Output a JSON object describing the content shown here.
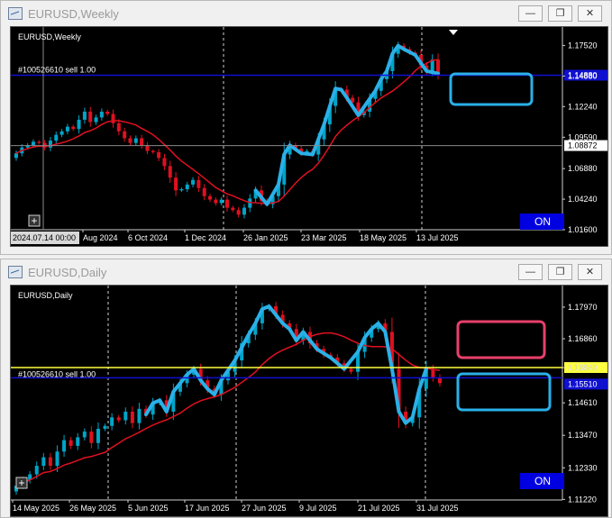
{
  "windows": [
    {
      "title": "EURUSD,Weekly",
      "symbol_label": "EURUSD,Weekly",
      "order_line_label": "#100526610 sell 1.00",
      "on_label": "ON",
      "price_labels": [
        "1.17520",
        "1.14880",
        "1.12240",
        "1.09590",
        "1.06880",
        "1.04240",
        "1.01600"
      ],
      "current_price_tag": "1.14880",
      "crosshair_price_tag": "1.08872",
      "crosshair_date_tag": "2024.07.14 00:00",
      "date_labels": [
        "Aug 2024",
        "6 Oct 2024",
        "1 Dec 2024",
        "26 Jan 2025",
        "23 Mar 2025",
        "18 May 2025",
        "13 Jul 2025"
      ],
      "colors": {
        "bull": "#00a5c8",
        "bear": "#e01020",
        "ma": "#e01020",
        "drawing": "#2ab0e8",
        "order_line": "#1010d0",
        "box": "#2ab0e8"
      },
      "chart_data": {
        "type": "candlestick",
        "timeframe": "Weekly",
        "ylim": [
          1.016,
          1.188
        ],
        "closes": [
          1.082,
          1.087,
          1.089,
          1.092,
          1.091,
          1.087,
          1.093,
          1.098,
          1.101,
          1.105,
          1.103,
          1.111,
          1.118,
          1.109,
          1.113,
          1.118,
          1.116,
          1.108,
          1.101,
          1.095,
          1.091,
          1.095,
          1.089,
          1.084,
          1.083,
          1.078,
          1.071,
          1.061,
          1.05,
          1.051,
          1.055,
          1.059,
          1.052,
          1.045,
          1.042,
          1.039,
          1.042,
          1.035,
          1.033,
          1.029,
          1.035,
          1.043,
          1.05,
          1.041,
          1.038,
          1.045,
          1.055,
          1.081,
          1.089,
          1.086,
          1.082,
          1.084,
          1.081,
          1.094,
          1.107,
          1.123,
          1.138,
          1.137,
          1.13,
          1.126,
          1.115,
          1.118,
          1.129,
          1.136,
          1.146,
          1.153,
          1.168,
          1.175,
          1.172,
          1.169,
          1.167,
          1.158,
          1.153,
          1.163,
          1.151
        ],
        "moving_average": "red"
      }
    },
    {
      "title": "EURUSD,Daily",
      "symbol_label": "EURUSD,Daily",
      "order_line_label": "#100526610 sell 1.00",
      "on_label": "ON",
      "price_labels": [
        "1.17970",
        "1.16860",
        "1.15849",
        "1.14610",
        "1.13470",
        "1.12330",
        "1.11220"
      ],
      "current_price_tag": "1.15510",
      "yellow_level_tag": "1.15849",
      "date_labels": [
        "14 May 2025",
        "26 May 2025",
        "5 Jun 2025",
        "17 Jun 2025",
        "27 Jun 2025",
        "9 Jul 2025",
        "21 Jul 2025",
        "31 Jul 2025"
      ],
      "colors": {
        "bull": "#00a5c8",
        "bear": "#e01020",
        "ma": "#e01020",
        "drawing": "#2ab0e8",
        "order_line": "#1010d0",
        "yellow_line": "#ffff40",
        "box_upper": "#e8406a",
        "box_lower": "#2ab0e8"
      },
      "chart_data": {
        "type": "candlestick",
        "timeframe": "Daily",
        "ylim": [
          1.112,
          1.186
        ],
        "closes": [
          1.117,
          1.119,
          1.121,
          1.124,
          1.127,
          1.124,
          1.129,
          1.133,
          1.131,
          1.134,
          1.136,
          1.132,
          1.137,
          1.138,
          1.141,
          1.14,
          1.143,
          1.139,
          1.144,
          1.142,
          1.146,
          1.147,
          1.143,
          1.15,
          1.153,
          1.156,
          1.158,
          1.154,
          1.151,
          1.149,
          1.154,
          1.157,
          1.161,
          1.167,
          1.17,
          1.174,
          1.179,
          1.18,
          1.177,
          1.174,
          1.172,
          1.168,
          1.171,
          1.167,
          1.165,
          1.163,
          1.162,
          1.16,
          1.158,
          1.157,
          1.164,
          1.169,
          1.172,
          1.174,
          1.171,
          1.158,
          1.143,
          1.139,
          1.141,
          1.151,
          1.158,
          1.155,
          1.153
        ],
        "moving_average": "red"
      }
    }
  ],
  "window_buttons": {
    "minimize": "—",
    "maximize": "❐",
    "close": "✕"
  },
  "plus_glyph": "+"
}
